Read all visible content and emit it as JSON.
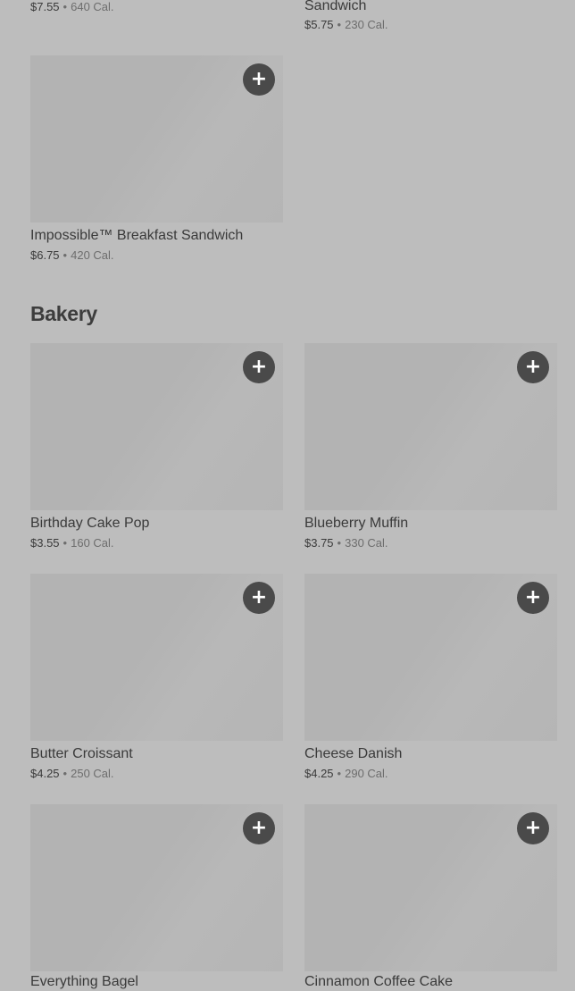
{
  "icons": {
    "add": "plus-icon",
    "add_glyph": "+"
  },
  "separator": "•",
  "top_partial": {
    "left": {
      "price": "$7.55",
      "calories": "640 Cal."
    },
    "right": {
      "name_tail": "Sandwich",
      "price": "$5.75",
      "calories": "230 Cal."
    }
  },
  "breakfast_last": {
    "name": "Impossible™ Breakfast Sandwich",
    "price": "$6.75",
    "calories": "420 Cal."
  },
  "bakery": {
    "title": "Bakery",
    "items": [
      {
        "name": "Birthday Cake Pop",
        "price": "$3.55",
        "calories": "160 Cal."
      },
      {
        "name": "Blueberry Muffin",
        "price": "$3.75",
        "calories": "330 Cal."
      },
      {
        "name": "Butter Croissant",
        "price": "$4.25",
        "calories": "250 Cal."
      },
      {
        "name": "Cheese Danish",
        "price": "$4.25",
        "calories": "290 Cal."
      },
      {
        "name": "Everything Bagel"
      },
      {
        "name": "Cinnamon Coffee Cake"
      }
    ]
  }
}
